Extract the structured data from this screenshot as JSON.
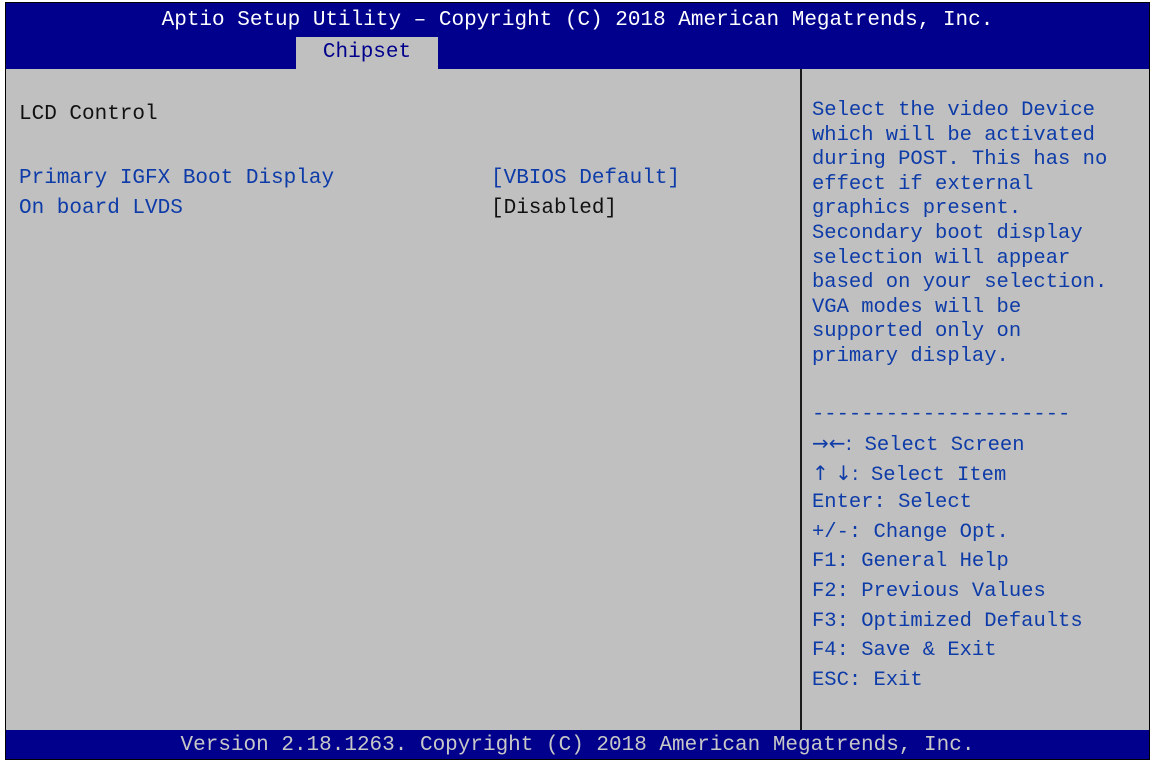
{
  "header": {
    "title": "Aptio Setup Utility – Copyright (C) 2018 American Megatrends, Inc.",
    "active_tab": "Chipset"
  },
  "main": {
    "section_heading": "LCD Control",
    "settings": [
      {
        "label": "Primary IGFX Boot Display",
        "value": "[VBIOS Default]"
      },
      {
        "label": "On board LVDS",
        "value": "[Disabled]"
      }
    ]
  },
  "help": {
    "description": "Select the video Device\nwhich will be activated\nduring POST. This has no\neffect if external\ngraphics present.\nSecondary boot display\nselection will appear\nbased on your selection.\nVGA modes will be\nsupported only on\nprimary display.",
    "separator": "---------------------",
    "keys": [
      {
        "key": "→←:",
        "action": "Select Screen"
      },
      {
        "key": "↑ ↓:",
        "action": "Select Item"
      },
      {
        "key": "Enter:",
        "action": "Select"
      },
      {
        "key": "+/-:",
        "action": "Change Opt."
      },
      {
        "key": "F1:",
        "action": "General Help"
      },
      {
        "key": "F2:",
        "action": "Previous Values"
      },
      {
        "key": "F3:",
        "action": "Optimized Defaults"
      },
      {
        "key": "F4:",
        "action": "Save & Exit"
      },
      {
        "key": "ESC:",
        "action": "Exit"
      }
    ]
  },
  "footer": {
    "text": "Version 2.18.1263. Copyright (C) 2018 American Megatrends, Inc."
  },
  "colors": {
    "header_bg": "#00008c",
    "body_bg": "#c0c0c0",
    "option_text": "#0d3ba8",
    "static_text": "#111111",
    "footer_text": "#c8c8c8"
  }
}
